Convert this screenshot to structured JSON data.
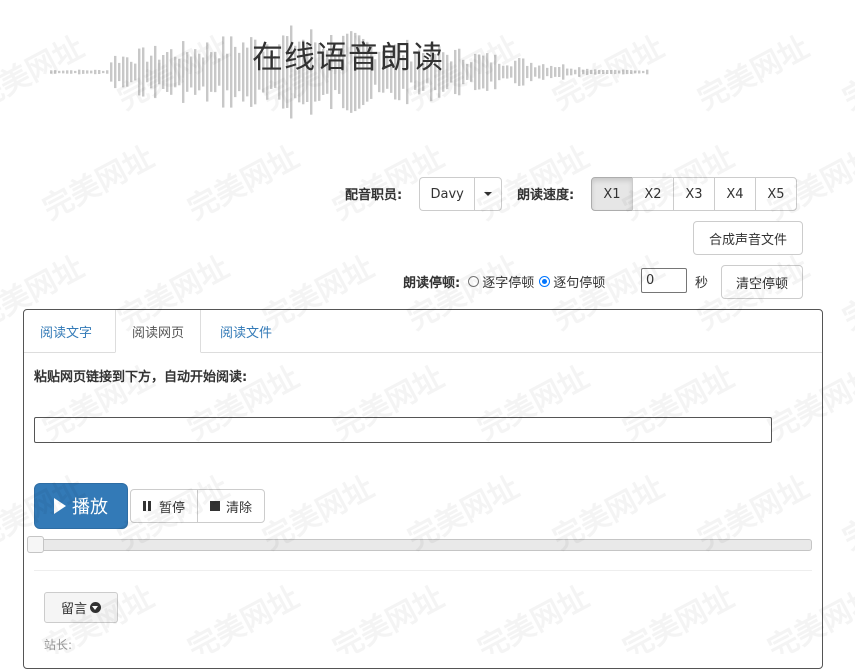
{
  "header": {
    "title": "在线语音朗读"
  },
  "voice": {
    "label": "配音职员:",
    "value": "Davy"
  },
  "speed": {
    "label": "朗读速度:",
    "options": [
      "X1",
      "X2",
      "X3",
      "X4",
      "X5"
    ],
    "selected": "X1"
  },
  "synth_button": "合成声音文件",
  "pause_settings": {
    "label": "朗读停顿:",
    "options": [
      "逐字停顿",
      "逐句停顿"
    ],
    "selected": "逐句停顿",
    "seconds_value": "0",
    "seconds_unit": "秒",
    "clear_button": "清空停顿"
  },
  "tabs": [
    {
      "label": "阅读文字"
    },
    {
      "label": "阅读网页"
    },
    {
      "label": "阅读文件"
    }
  ],
  "active_tab": "阅读网页",
  "instruction": "粘贴网页链接到下方，自动开始阅读:",
  "url_input": {
    "value": "",
    "placeholder": ""
  },
  "controls": {
    "play": "播放",
    "pause": "暂停",
    "clear": "清除"
  },
  "progress": {
    "fraction": 0
  },
  "message": {
    "button": "留言",
    "owner_label": "站长:"
  },
  "watermark": "完美网址",
  "icons": {
    "play": "play-icon",
    "pause": "pause-icon",
    "stop": "stop-icon",
    "dropdown": "caret-down-icon",
    "message": "circle-chevron-down-icon"
  },
  "colors": {
    "primary": "#337ab7",
    "text": "#333333",
    "link": "#337ab7"
  }
}
